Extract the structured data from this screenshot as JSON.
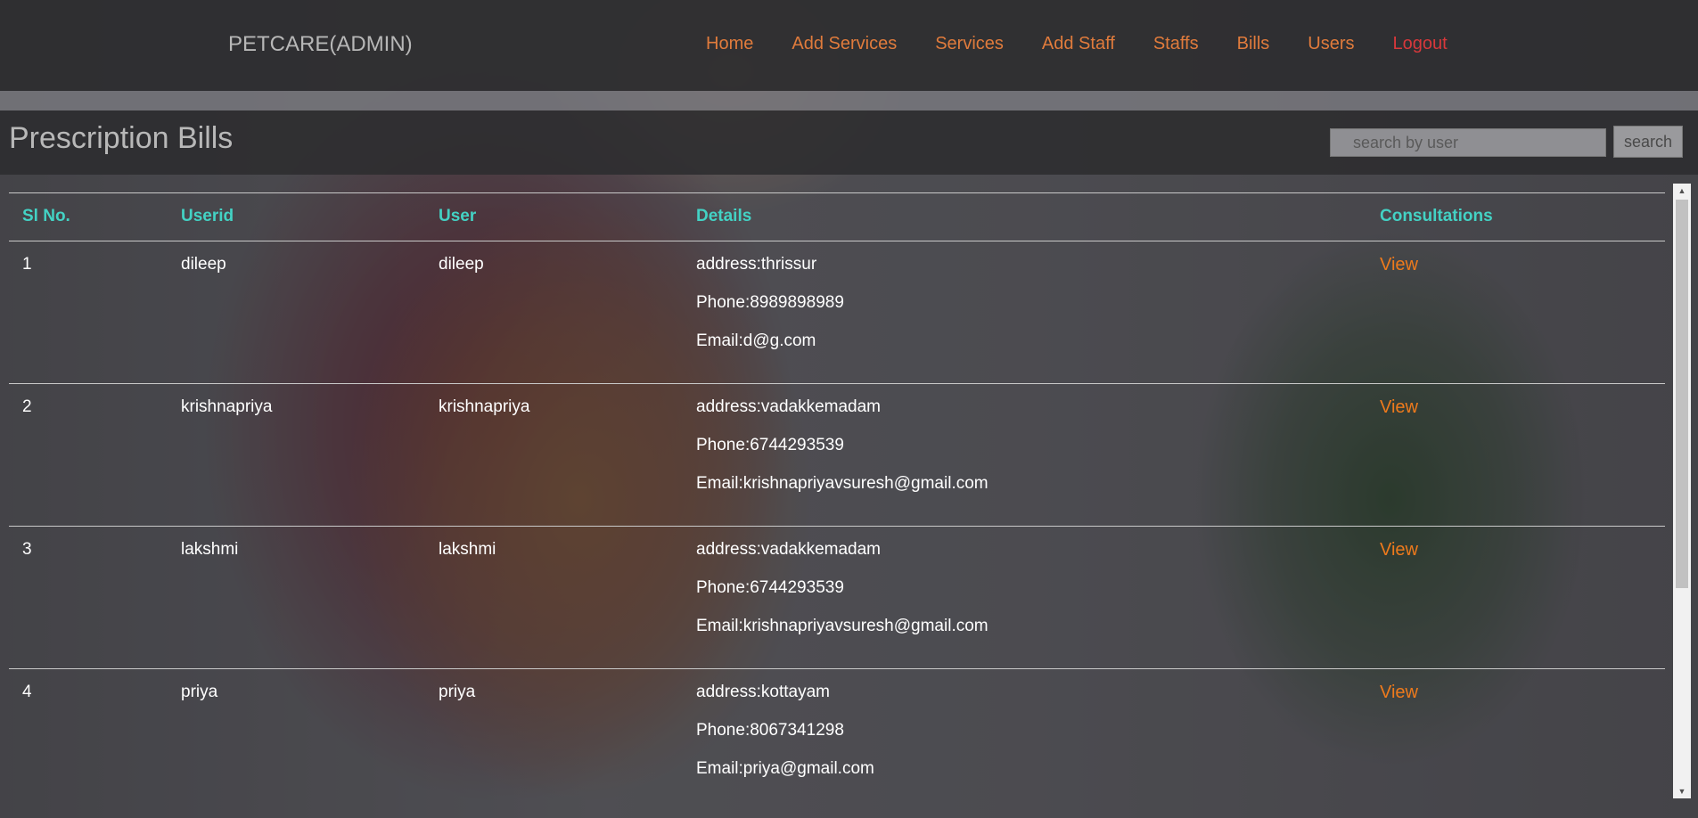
{
  "header": {
    "brand": "PETCARE(ADMIN)"
  },
  "nav": {
    "items": [
      "Home",
      "Add Services",
      "Services",
      "Add Staff",
      "Staffs",
      "Bills",
      "Users",
      "Logout"
    ]
  },
  "page": {
    "title": "Prescription Bills"
  },
  "search": {
    "placeholder": "search by user",
    "value": "",
    "button_label": "search"
  },
  "table": {
    "columns": [
      "Sl No.",
      "Userid",
      "User",
      "Details",
      "Consultations"
    ],
    "rows": [
      {
        "sl": "1",
        "userid": "dileep",
        "user": "dileep",
        "address": "address:thrissur",
        "phone": "Phone:8989898989",
        "email": "Email:d@g.com",
        "action": "View"
      },
      {
        "sl": "2",
        "userid": "krishnapriya",
        "user": "krishnapriya",
        "address": "address:vadakkemadam",
        "phone": "Phone:6744293539",
        "email": "Email:krishnapriyavsuresh@gmail.com",
        "action": "View"
      },
      {
        "sl": "3",
        "userid": "lakshmi",
        "user": "lakshmi",
        "address": "address:vadakkemadam",
        "phone": "Phone:6744293539",
        "email": "Email:krishnapriyavsuresh@gmail.com",
        "action": "View"
      },
      {
        "sl": "4",
        "userid": "priya",
        "user": "priya",
        "address": "address:kottayam",
        "phone": "Phone:8067341298",
        "email": "Email:priya@gmail.com",
        "action": "View"
      }
    ]
  },
  "colors": {
    "nav_link": "#e07b3c",
    "logout": "#d8383b",
    "column_header": "#43d2c4",
    "view_link": "#ee7a1c"
  },
  "icons": {
    "scroll_up": "chevron-up-icon",
    "scroll_down": "chevron-down-icon"
  }
}
